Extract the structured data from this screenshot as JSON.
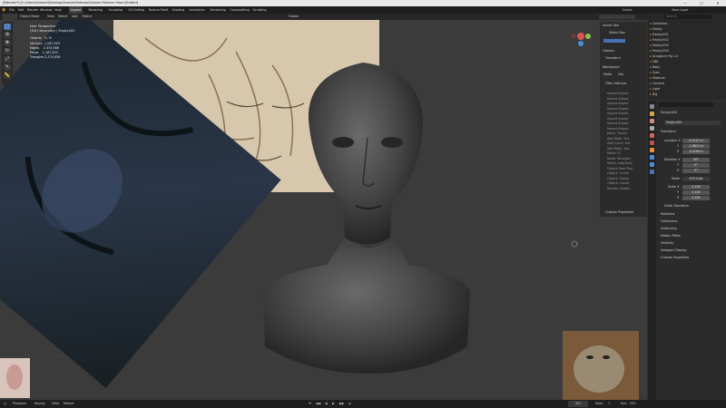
{
  "window": {
    "title": "[Blender*] [C:\\Users\\Amber\\Desktop\\Scenes\\Patreon\\Scenes Patreon Head [Edited]",
    "controls": [
      "—",
      "☐",
      "✕"
    ]
  },
  "menubar": {
    "menus": [
      "File",
      "Edit",
      "Render",
      "Window",
      "Help"
    ],
    "workspace_tabs": [
      "Layout",
      "Modeling",
      "Sculpting",
      "UV Editing",
      "Texture Paint",
      "Shading",
      "Animation",
      "Rendering",
      "Compositing",
      "Scripting"
    ],
    "active_workspace": "Layout",
    "scene_label": "Scene",
    "view_layer_label": "View Layer"
  },
  "viewport_header": {
    "mode": "Object Mode",
    "menus": [
      "View",
      "Select",
      "Add",
      "Object"
    ],
    "transform": "Global"
  },
  "viewport_overlay": {
    "view_name": "User Perspective",
    "collection": "(301) Secondary | Empty.000",
    "stats": [
      {
        "label": "Objects",
        "value": "0 / 8"
      },
      {
        "label": "Vertices",
        "value": "1,187,543"
      },
      {
        "label": "Edges",
        "value": "2,374,986"
      },
      {
        "label": "Faces",
        "value": "1,187,622"
      },
      {
        "label": "Triangles",
        "value": "2,374,936"
      }
    ]
  },
  "npanel": {
    "active_tool_title": "Active Tool",
    "active_tool_name": "Select Box",
    "options_title": "Options",
    "transform_label": "Transform",
    "workspace_title": "Workspace",
    "mode_label": "Mode",
    "mode_value": "Obj",
    "filter_addons": "Filter Add-ons",
    "addon_items": [
      "Import-Export",
      "Import-Export",
      "Import-Export",
      "Import-Export",
      "Import-Export",
      "Import-Export",
      "Import-Export",
      "Import-Export",
      "Mesh: Tissue",
      "Add Mesh: Ext",
      "Add Curve: Ext",
      "Add Mesh: Ant",
      "Mesh: F2",
      "Node: Wrangler",
      "Mesh: LoopTools",
      "Object: Bool Tool",
      "Object: Carver",
      "Object: Carver",
      "Object: Carver",
      "Render: Nodes"
    ],
    "custom_props": "Custom Properties"
  },
  "outliner": {
    "search_placeholder": "Search",
    "items": [
      "Collection",
      "Empty",
      "Empty.001",
      "Empty.002",
      "Empty.003",
      "Empty.004",
      "Sculpture Fig 1.0",
      "FBX",
      "Body",
      "Eyes",
      "Material",
      "Camera",
      "Light",
      "Rig"
    ]
  },
  "properties": {
    "search_placeholder": "",
    "object_name": "Empty.000",
    "object_name_field": "Empty.000",
    "transform_title": "Transform",
    "location_label": "Location X",
    "location": [
      "0.1547 m",
      "-1.8613 m",
      "11.836 m"
    ],
    "rotation_label": "Rotation X",
    "rotation": [
      "90°",
      "0°",
      "0°"
    ],
    "mode_label": "Mode",
    "mode_value": "XYZ Euler",
    "scale_label": "Scale X",
    "scale": [
      "0.100",
      "0.100",
      "0.100"
    ],
    "axis_labels": [
      "Y",
      "Z",
      "Y",
      "Z",
      "Y",
      "Z"
    ],
    "delta_transform": "Delta Transform",
    "sections": [
      "Relations",
      "Collections",
      "Instancing",
      "Motion Paths",
      "Visibility",
      "Viewport Display",
      "Custom Properties"
    ]
  },
  "timeline": {
    "playback": "Playback",
    "keying": "Keying",
    "view": "View",
    "marker": "Marker",
    "current_frame": "301",
    "start_label": "Start",
    "start": "1",
    "end_label": "End",
    "end": "250",
    "transport": [
      "⏮",
      "◀◀",
      "◀",
      "▶",
      "▶▶",
      "⏭"
    ]
  },
  "colors": {
    "accent_blue": "#4772b3",
    "viewport_bg": "#3b3b3b",
    "panel_bg": "#2b2b2b",
    "orange_icon": "#e8913a"
  }
}
